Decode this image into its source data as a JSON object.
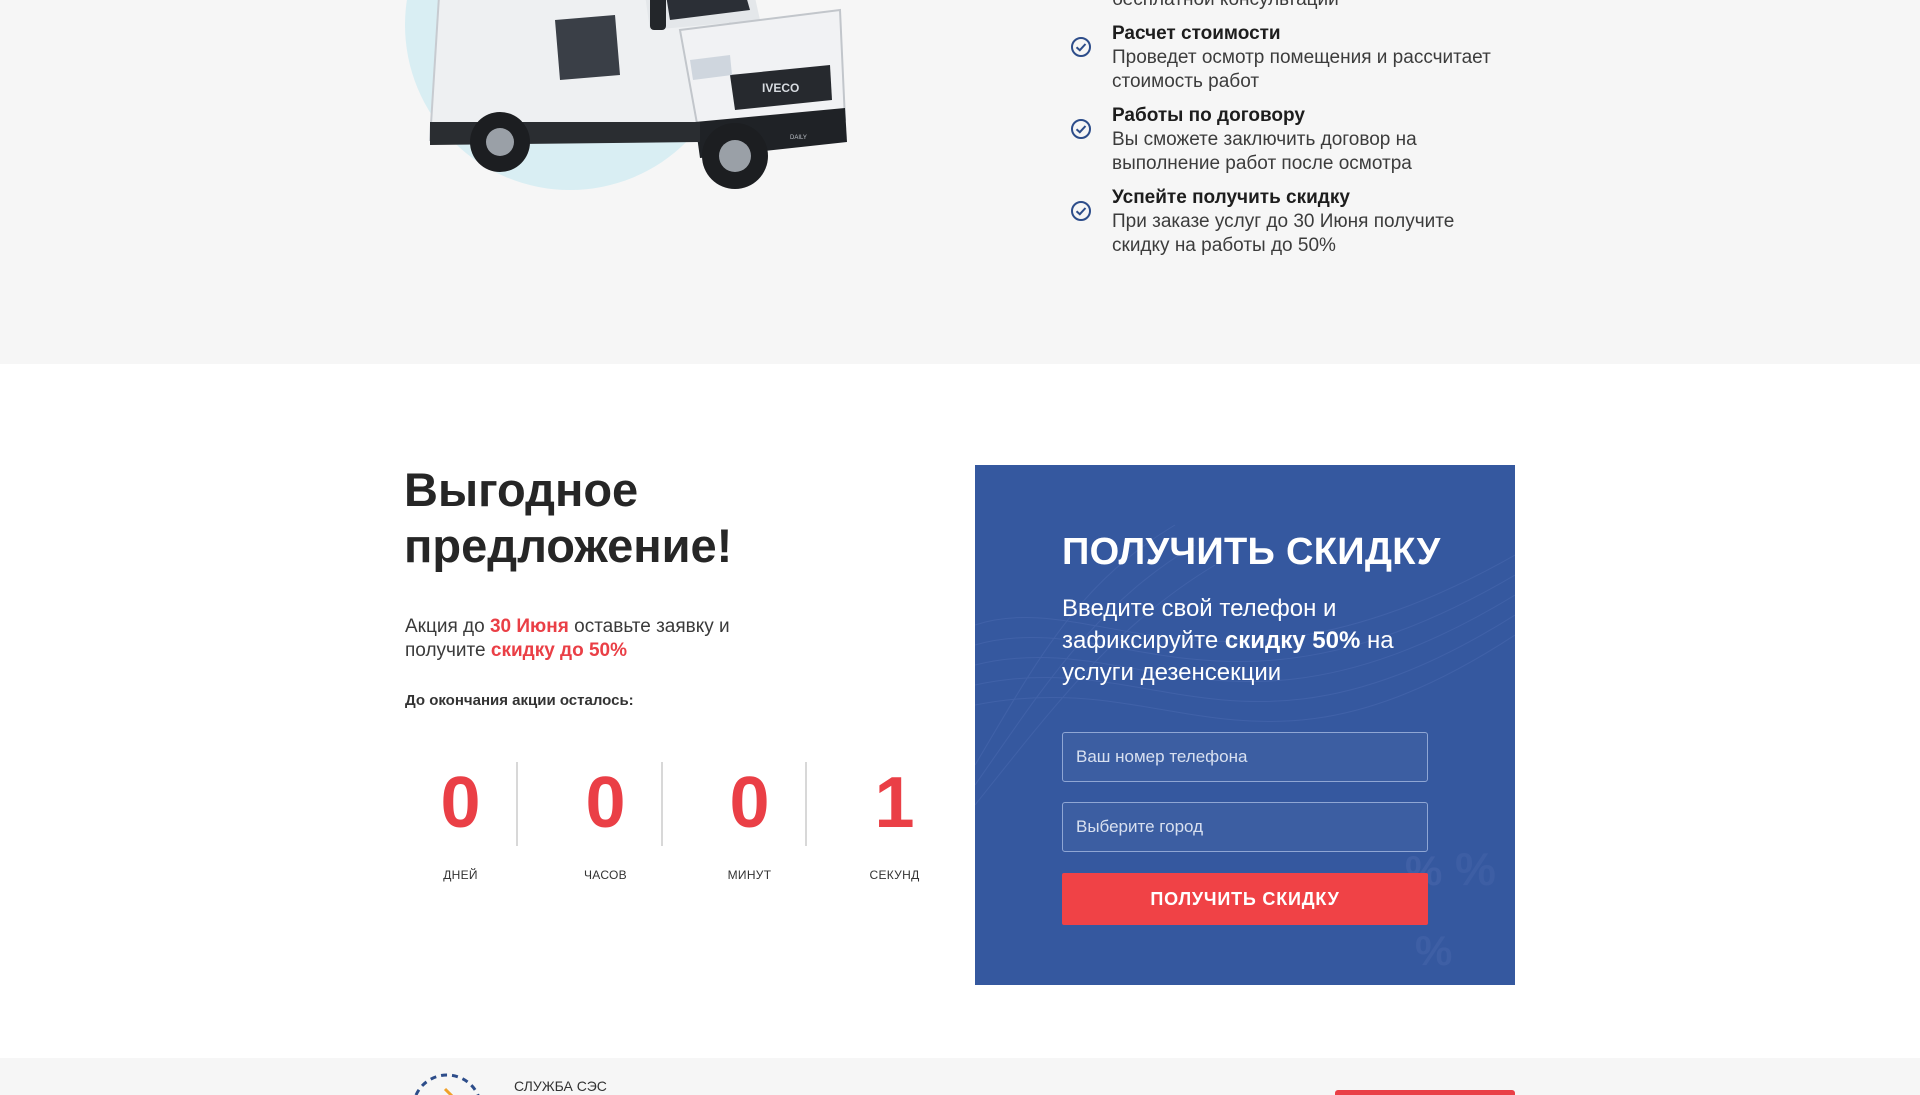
{
  "features": [
    {
      "title": "",
      "desc": "бесплатной консультации"
    },
    {
      "title": "Расчет стоимости",
      "desc": "Проведет осмотр помещения и рассчитает стоимость работ"
    },
    {
      "title": "Работы по договору",
      "desc": "Вы сможете заключить договор на выполнение работ после осмотра"
    },
    {
      "title": "Успейте получить скидку",
      "desc": "При заказе услуг до 30 Июня получите скидку на работы до 50%"
    }
  ],
  "van": {
    "brand_text": "IVECO",
    "plate_text": "DAILY"
  },
  "offer": {
    "title": "Выгодное предложение!",
    "text_part1": "Акция до ",
    "text_date": "30 Июня",
    "text_part2": " оставьте заявку и получите ",
    "text_discount": "скидку до 50%",
    "countdown_label": "До окончания акции осталось:"
  },
  "countdown": [
    {
      "value": "0",
      "unit": "ДНЕЙ"
    },
    {
      "value": "0",
      "unit": "ЧАСОВ"
    },
    {
      "value": "0",
      "unit": "МИНУТ"
    },
    {
      "value": "1",
      "unit": "СЕКУНД"
    }
  ],
  "form": {
    "title": "ПОЛУЧИТЬ СКИДКУ",
    "subtitle_part1": "Введите свой телефон и зафиксируйте ",
    "subtitle_bold": "скидку 50%",
    "subtitle_part2": " на услуги дезенсекции",
    "phone_placeholder": "Ваш номер телефона",
    "city_placeholder": "Выберите город",
    "submit_label": "ПОЛУЧИТЬ СКИДКУ"
  },
  "footer": {
    "brand": "СЛУЖБА СЭС"
  },
  "colors": {
    "accent_red": "#ea3f46",
    "card_blue": "#35589f",
    "check_blue": "#2d4d8a",
    "van_circle": "#d9eef3"
  }
}
